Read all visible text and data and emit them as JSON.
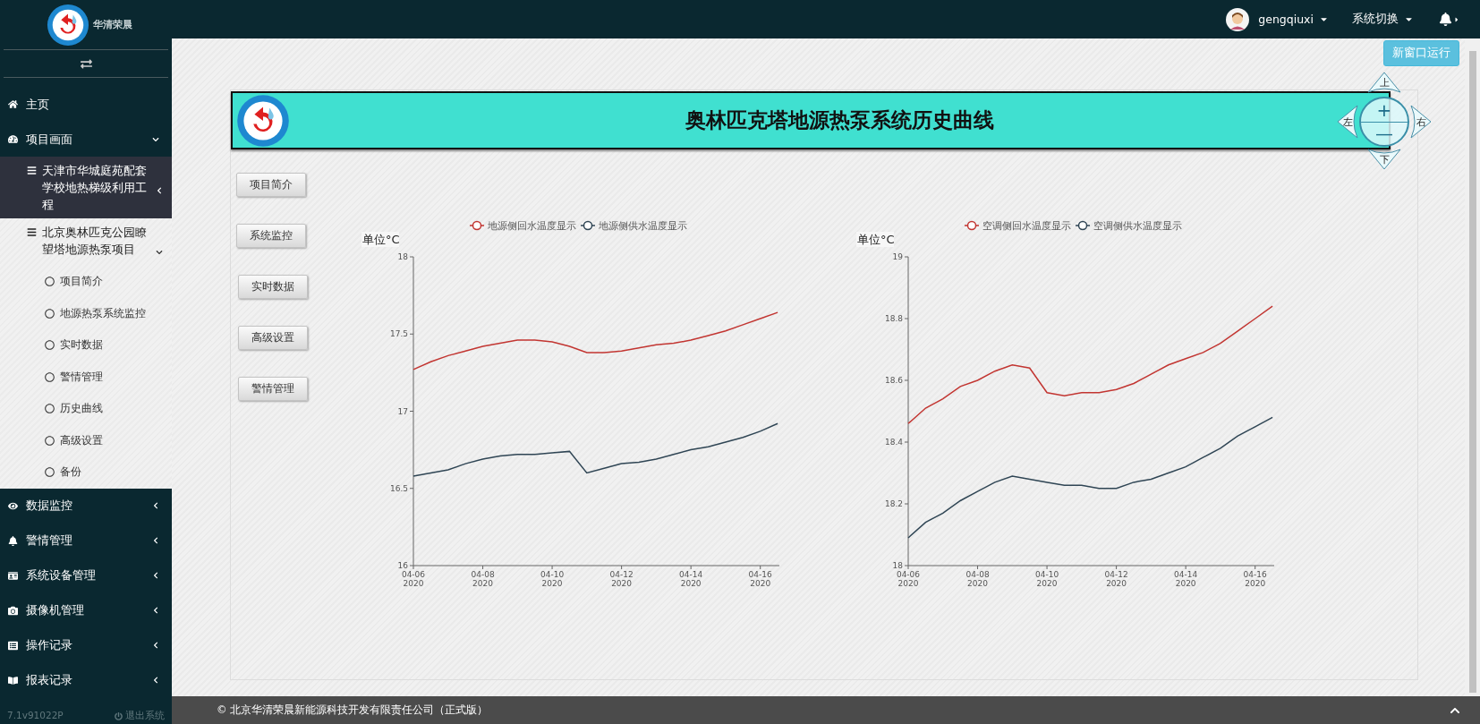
{
  "sidebar": {
    "logo_text": "华清荣晨",
    "items": [
      {
        "label": "主页"
      },
      {
        "label": "项目画面",
        "expanded": true,
        "children": [
          {
            "label": "天津市华城庭苑配套学校地热梯级利用工程",
            "highlighted": true,
            "expanded": false
          },
          {
            "label": "北京奥林匹克公园瞭望塔地源热泵项目",
            "highlighted": false,
            "expanded": true,
            "children": [
              {
                "label": "项目简介"
              },
              {
                "label": "地源热泵系统监控"
              },
              {
                "label": "实时数据"
              },
              {
                "label": "警情管理"
              },
              {
                "label": "历史曲线"
              },
              {
                "label": "高级设置"
              },
              {
                "label": "备份"
              }
            ]
          }
        ]
      },
      {
        "label": "数据监控",
        "expanded": false
      },
      {
        "label": "警情管理",
        "expanded": false
      },
      {
        "label": "系统设备管理",
        "expanded": false
      },
      {
        "label": "摄像机管理",
        "expanded": false
      },
      {
        "label": "操作记录",
        "expanded": false
      },
      {
        "label": "报表记录",
        "expanded": false
      }
    ],
    "version": "7.1v91022P",
    "logout": "退出系统"
  },
  "topbar": {
    "username": "gengqiuxi",
    "system_switch": "系统切换"
  },
  "new_window_button": "新窗口运行",
  "title": "奥林匹克塔地源热泵系统历史曲线",
  "nav_control": {
    "up": "上",
    "down": "下",
    "left": "左",
    "right": "右",
    "zoom_in": "+",
    "zoom_out": "—"
  },
  "side_buttons": [
    "项目简介",
    "系统监控",
    "实时数据",
    "高级设置",
    "警情管理"
  ],
  "charts": [
    {
      "unit_label": "单位°C",
      "chart_data": {
        "type": "line",
        "legend": "top",
        "categories": [
          "04-06 2020",
          null,
          null,
          null,
          "04-08 2020",
          null,
          null,
          null,
          "04-10 2020",
          null,
          null,
          null,
          "04-12 2020",
          null,
          null,
          null,
          "04-14 2020",
          null,
          null,
          null,
          "04-16 2020",
          null
        ],
        "ylim": [
          16,
          18
        ],
        "yticks": [
          16,
          16.5,
          17,
          17.5,
          18
        ],
        "series": [
          {
            "name": "地源侧回水温度显示",
            "color": "#c23531",
            "values": [
              17.27,
              17.32,
              17.36,
              17.39,
              17.42,
              17.44,
              17.46,
              17.46,
              17.45,
              17.42,
              17.38,
              17.38,
              17.39,
              17.41,
              17.43,
              17.44,
              17.46,
              17.49,
              17.52,
              17.56,
              17.6,
              17.64
            ]
          },
          {
            "name": "地源侧供水温度显示",
            "color": "#2f4554",
            "values": [
              16.58,
              16.6,
              16.62,
              16.66,
              16.69,
              16.71,
              16.72,
              16.72,
              16.73,
              16.74,
              16.6,
              16.63,
              16.66,
              16.67,
              16.69,
              16.72,
              16.75,
              16.77,
              16.8,
              16.83,
              16.87,
              16.92
            ]
          }
        ]
      }
    },
    {
      "unit_label": "单位°C",
      "chart_data": {
        "type": "line",
        "legend": "top",
        "categories": [
          "04-06 2020",
          null,
          null,
          null,
          "04-08 2020",
          null,
          null,
          null,
          "04-10 2020",
          null,
          null,
          null,
          "04-12 2020",
          null,
          null,
          null,
          "04-14 2020",
          null,
          null,
          null,
          "04-16 2020",
          null
        ],
        "ylim": [
          18,
          19
        ],
        "yticks": [
          18,
          18.2,
          18.4,
          18.6,
          18.8,
          19
        ],
        "series": [
          {
            "name": "空调侧回水温度显示",
            "color": "#c23531",
            "values": [
              18.46,
              18.51,
              18.54,
              18.58,
              18.6,
              18.63,
              18.65,
              18.64,
              18.56,
              18.55,
              18.56,
              18.56,
              18.57,
              18.59,
              18.62,
              18.65,
              18.67,
              18.69,
              18.72,
              18.76,
              18.8,
              18.84
            ]
          },
          {
            "name": "空调侧供水温度显示",
            "color": "#2f4554",
            "values": [
              18.09,
              18.14,
              18.17,
              18.21,
              18.24,
              18.27,
              18.29,
              18.28,
              18.27,
              18.26,
              18.26,
              18.25,
              18.25,
              18.27,
              18.28,
              18.3,
              18.32,
              18.35,
              18.38,
              18.42,
              18.45,
              18.48
            ]
          }
        ]
      }
    }
  ],
  "footer": "© 北京华清荣晨新能源科技开发有限责任公司（正式版）"
}
